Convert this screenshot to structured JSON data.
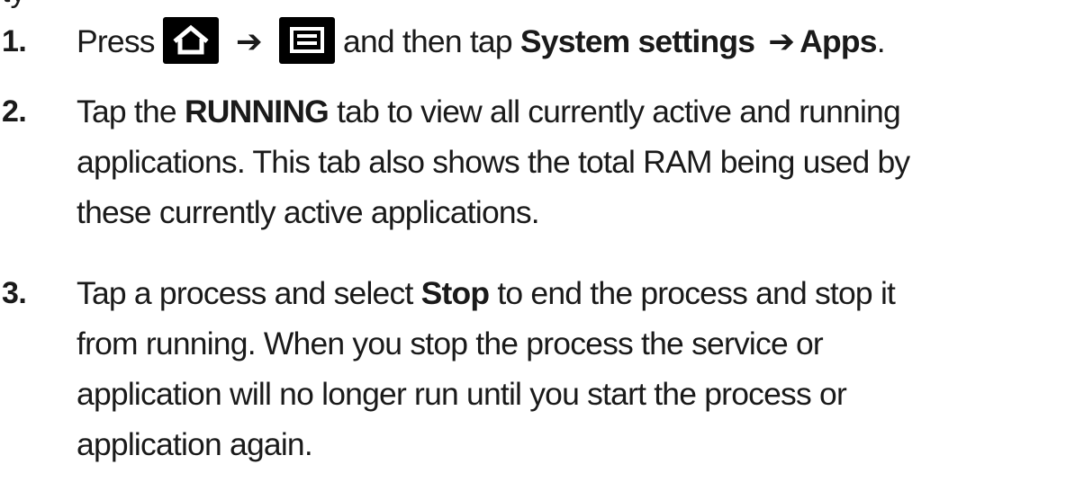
{
  "step1": {
    "number": "1.",
    "press": "Press",
    "home_icon": "home-icon",
    "arrow": "➔",
    "menu_icon": "menu-icon",
    "after_icons": "and then tap",
    "system_settings": "System settings",
    "arrow2": "➔",
    "apps": "Apps",
    "end": "."
  },
  "step2": {
    "number": "2.",
    "pre": "Tap the",
    "running": "RUNNING",
    "line1_post": "tab to view all currently active and running",
    "line2": "applications. This tab also shows the total RAM being used by",
    "line3": "these currently active applications."
  },
  "step3": {
    "number": "3.",
    "pre": "Tap a process and select",
    "stop": "Stop",
    "line1_post": "to end the process and stop it",
    "line2": "from running. When you stop the process the service or",
    "line3": "application will no longer run until you start the process or",
    "line4": "application again."
  },
  "colors": {
    "text": "#1a1a1a",
    "icon_bg": "#000000",
    "icon_fg": "#ffffff"
  }
}
